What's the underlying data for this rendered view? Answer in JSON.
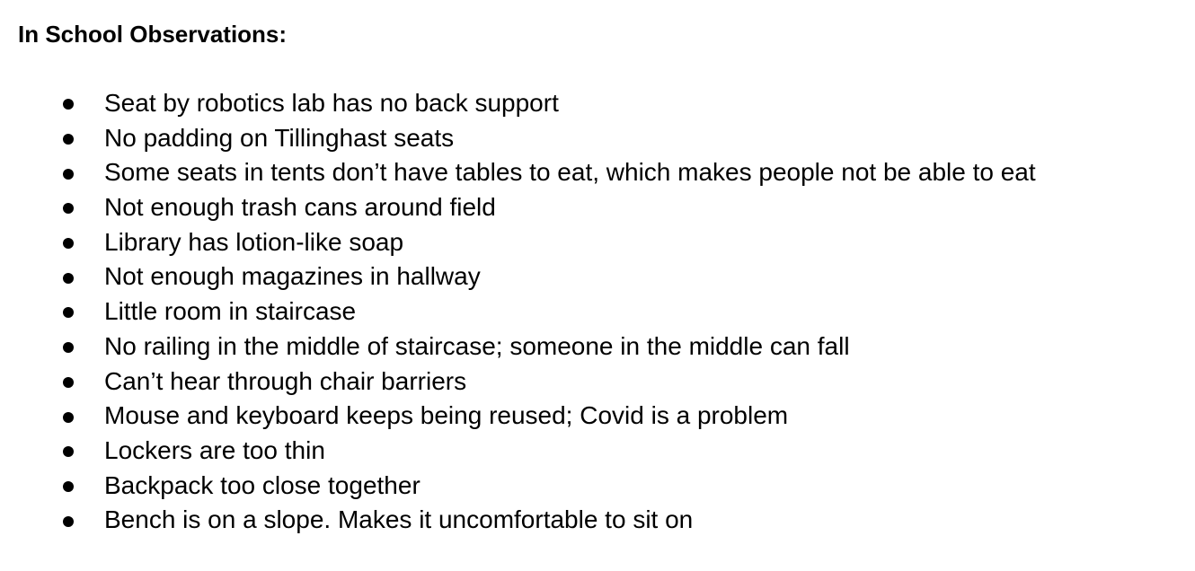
{
  "document": {
    "heading": "In School Observations:",
    "items": [
      "Seat by robotics lab has no back support",
      "No padding on Tillinghast seats",
      "Some seats in tents don’t have tables to eat, which makes people not be able to eat",
      "Not enough trash cans around field",
      "Library has lotion-like soap",
      "Not enough magazines in hallway",
      "Little room in staircase",
      "No railing in the middle of staircase; someone in the middle can fall",
      "Can’t hear through chair barriers",
      "Mouse and keyboard keeps being reused; Covid is a problem",
      "Lockers are too thin",
      "Backpack too close together",
      "Bench is on a slope. Makes it uncomfortable to sit on"
    ]
  }
}
